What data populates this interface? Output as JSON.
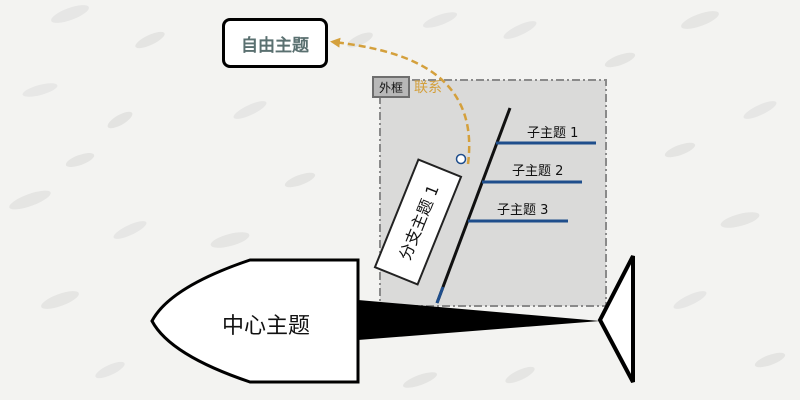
{
  "diagram": {
    "type": "fishbone",
    "center_topic": "中心主题",
    "free_topic": "自由主题",
    "frame_label": "外框",
    "relationship_label": "联系",
    "branch_topic": "分支主题 1",
    "sub_topics": [
      "子主题 1",
      "子主题 2",
      "子主题 3"
    ]
  },
  "colors": {
    "background": "#f3f3f1",
    "relationship": "#d4a03c",
    "sub_topic_line": "#1f4e8c",
    "frame_fill": "#cfcfcf",
    "frame_border": "#8a8a8a",
    "fish": "#000000",
    "free_topic_text": "#5a7070"
  }
}
